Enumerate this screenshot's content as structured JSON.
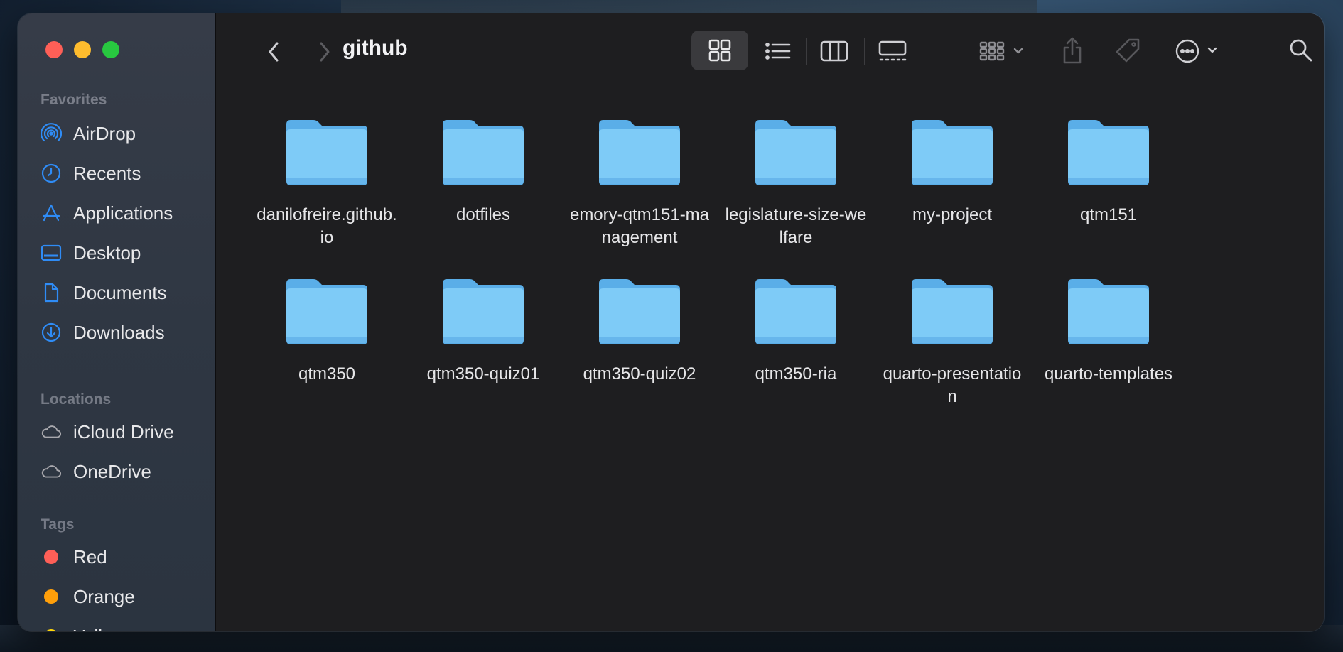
{
  "window": {
    "title": "github"
  },
  "sidebar": {
    "sections": [
      {
        "title": "Favorites",
        "items": [
          {
            "label": "AirDrop",
            "icon": "airdrop-icon"
          },
          {
            "label": "Recents",
            "icon": "clock-icon"
          },
          {
            "label": "Applications",
            "icon": "applications-icon"
          },
          {
            "label": "Desktop",
            "icon": "desktop-icon"
          },
          {
            "label": "Documents",
            "icon": "document-icon"
          },
          {
            "label": "Downloads",
            "icon": "download-icon"
          }
        ]
      },
      {
        "title": "Locations",
        "items": [
          {
            "label": "iCloud Drive",
            "icon": "cloud-icon"
          },
          {
            "label": "OneDrive",
            "icon": "cloud-icon"
          }
        ]
      },
      {
        "title": "Tags",
        "items": [
          {
            "label": "Red",
            "color": "#fe5f57"
          },
          {
            "label": "Orange",
            "color": "#ff9f0a"
          },
          {
            "label": "Yellow",
            "color": "#ffd60a"
          }
        ]
      }
    ]
  },
  "toolbar": {
    "active_view": "icon"
  },
  "files": [
    {
      "name": "danilofreire.github.io"
    },
    {
      "name": "dotfiles"
    },
    {
      "name": "emory-qtm151-management"
    },
    {
      "name": "legislature-size-welfare"
    },
    {
      "name": "my-project"
    },
    {
      "name": "qtm151"
    },
    {
      "name": "qtm350"
    },
    {
      "name": "qtm350-quiz01"
    },
    {
      "name": "qtm350-quiz02"
    },
    {
      "name": "qtm350-ria"
    },
    {
      "name": "quarto-presentation"
    },
    {
      "name": "quarto-templates"
    }
  ],
  "colors": {
    "accent": "#0a84ff",
    "folder_front": "#7ecbf7",
    "folder_back": "#5aaee8"
  }
}
